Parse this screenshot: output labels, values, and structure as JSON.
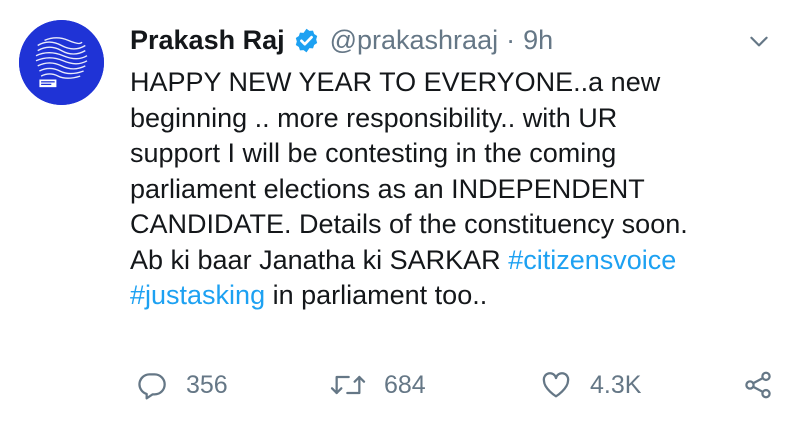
{
  "tweet": {
    "author_name": "Prakash Raj",
    "handle": "@prakashraaj",
    "separator": "·",
    "time": "9h",
    "lines": [
      [
        {
          "text": "HAPPY NEW YEAR TO EVERYONE..a new"
        }
      ],
      [
        {
          "text": "beginning .. more responsibility.. with UR"
        }
      ],
      [
        {
          "text": "support I will be contesting in the coming"
        }
      ],
      [
        {
          "text": "parliament elections as an INDEPENDENT"
        }
      ],
      [
        {
          "text": "CANDIDATE. Details of the constituency soon."
        }
      ],
      [
        {
          "text": "Ab ki baar Janatha ki  SARKAR "
        },
        {
          "text": "#citizensvoice",
          "hashtag": true
        }
      ],
      [
        {
          "text": "#justasking",
          "hashtag": true
        },
        {
          "text": " in parliament too.."
        }
      ]
    ]
  },
  "actions": {
    "reply_count": "356",
    "retweet_count": "684",
    "like_count": "4.3K"
  },
  "icons": {
    "verified": "verified-badge-icon",
    "menu": "chevron-down-icon",
    "reply": "reply-icon",
    "retweet": "retweet-icon",
    "like": "heart-icon",
    "share": "share-icon"
  },
  "colors": {
    "text": "#14171a",
    "secondary": "#657786",
    "accent": "#1da1f2",
    "avatar_bg": "#1f33d6"
  }
}
